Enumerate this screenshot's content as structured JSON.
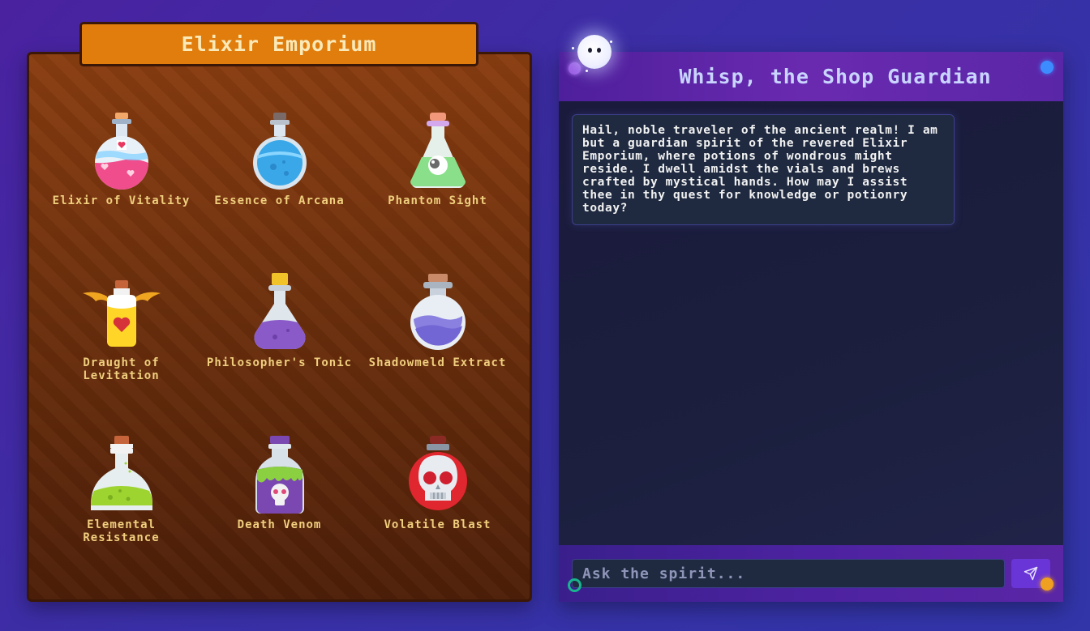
{
  "shop": {
    "title": "Elixir Emporium",
    "potions": [
      {
        "name": "Elixir of Vitality",
        "icon": "heart-potion-icon"
      },
      {
        "name": "Essence of Arcana",
        "icon": "blue-potion-icon"
      },
      {
        "name": "Phantom Sight",
        "icon": "eye-potion-icon"
      },
      {
        "name": "Draught of Levitation",
        "icon": "winged-potion-icon"
      },
      {
        "name": "Philosopher's Tonic",
        "icon": "purple-potion-icon"
      },
      {
        "name": "Shadowmeld Extract",
        "icon": "violet-flask-icon"
      },
      {
        "name": "Elemental Resistance",
        "icon": "green-flask-icon"
      },
      {
        "name": "Death Venom",
        "icon": "skull-bottle-icon"
      },
      {
        "name": "Volatile Blast",
        "icon": "skull-bomb-icon"
      }
    ]
  },
  "chat": {
    "title": "Whisp, the Shop Guardian",
    "avatar": "spirit-icon",
    "messages": [
      {
        "from": "spirit",
        "text": "Hail, noble traveler of the ancient realm! I am but a guardian spirit of the revered Elixir Emporium, where potions of wondrous might reside. I dwell amidst the vials and brews crafted by mystical hands. How may I assist thee in thy quest for knowledge or potionry today?"
      }
    ],
    "input": {
      "placeholder": "Ask the spirit...",
      "value": ""
    },
    "send_icon": "send-icon"
  },
  "colors": {
    "shop_title_bg": "#e07d0c",
    "shop_text": "#f0cf7e",
    "chat_header": "#6a2ab0",
    "send_button": "#6a35d6"
  }
}
